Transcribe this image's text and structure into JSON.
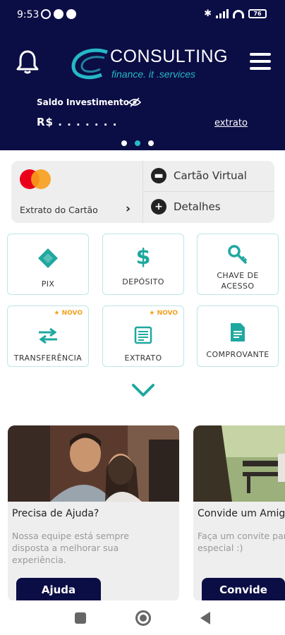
{
  "status_bar": {
    "time": "9:53",
    "battery": "76"
  },
  "header": {
    "logo_title": "CONSULTING",
    "logo_subtitle": "finance. it .services",
    "saldo_label": "Saldo Investimento",
    "saldo_value": "R$ . . . . . . .",
    "extrato_link": "extrato",
    "carousel_pages": 3,
    "carousel_active": 2
  },
  "card": {
    "extrato_label": "Extrato do Cartão",
    "virtual_label": "Cartão Virtual",
    "detalhes_label": "Detalhes"
  },
  "tiles": [
    {
      "label": "PIX",
      "icon": "pix-icon",
      "novo": ""
    },
    {
      "label": "DEPÓSITO",
      "icon": "dollar-icon",
      "novo": ""
    },
    {
      "label_line1": "CHAVE DE",
      "label_line2": "ACESSO",
      "icon": "key-icon",
      "novo": ""
    },
    {
      "label": "TRANSFERÊNCIA",
      "icon": "transfer-arrows-icon",
      "novo": "★ NOVO"
    },
    {
      "label": "EXTRATO",
      "icon": "statement-icon",
      "novo": "★ NOVO"
    },
    {
      "label": "COMPROVANTE",
      "icon": "receipt-icon",
      "novo": ""
    }
  ],
  "promos": [
    {
      "title": "Precisa de Ajuda?",
      "text_lines": [
        "Nossa equipe está sempre",
        "disposta a melhorar sua",
        "experiência."
      ],
      "button": "Ajuda"
    },
    {
      "title": "Convide um Amigo",
      "text_lines": [
        "Faça um convite para",
        "especial :)"
      ],
      "button": "Convide"
    }
  ],
  "colors": {
    "navy": "#0b0d45",
    "teal": "#26b8c6",
    "accent_new": "#f0a020"
  }
}
